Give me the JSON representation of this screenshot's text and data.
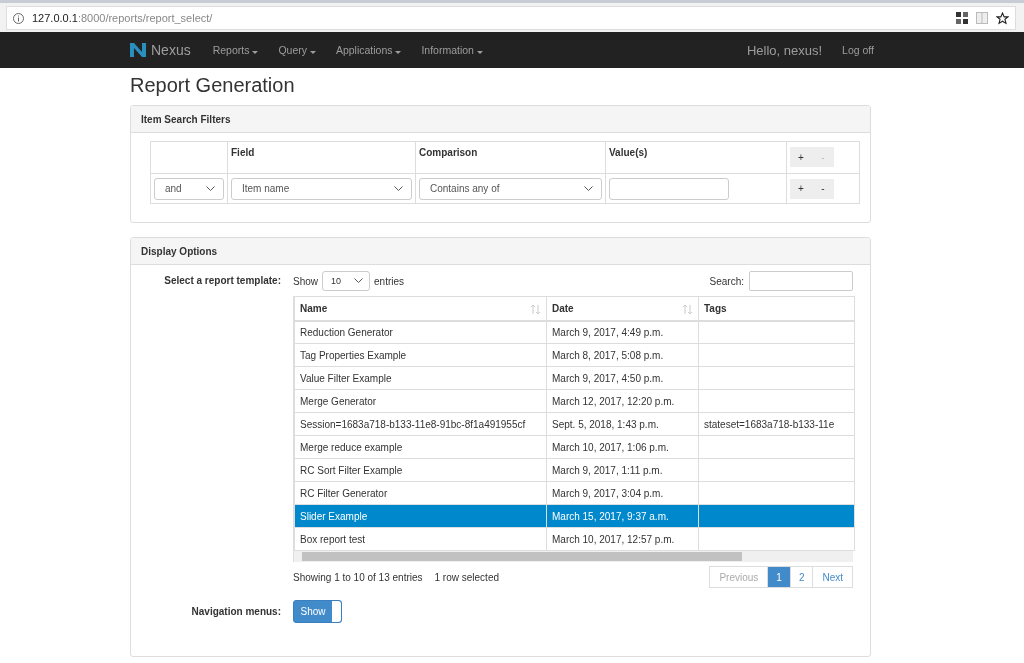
{
  "browser": {
    "url": "**127.0.0.1**:8000/reports/report_select/"
  },
  "navbar": {
    "brand": "Nexus",
    "menus": [
      "Reports",
      "Query",
      "Applications",
      "Information"
    ],
    "greeting": "Hello, nexus!",
    "logoff": "Log off"
  },
  "page_title": "Report Generation",
  "filters_panel": {
    "title": "Item Search Filters",
    "columns": [
      "Field",
      "Comparison",
      "Value(s)"
    ],
    "header_buttons": [
      {
        "label": "+",
        "disabled": false
      },
      {
        "label": "-",
        "disabled": true
      }
    ],
    "rows": [
      {
        "conjunction": "and",
        "field": "Item name",
        "comparison": "Contains any of",
        "value": "",
        "buttons": [
          {
            "label": "+",
            "disabled": false
          },
          {
            "label": "-",
            "disabled": false
          }
        ]
      }
    ]
  },
  "display_panel": {
    "title": "Display Options",
    "template_label": "Select a report template:",
    "length": {
      "before": "Show",
      "value": "10",
      "after": "entries"
    },
    "search_label": "Search:",
    "columns": [
      {
        "label": "Name",
        "sortable": true
      },
      {
        "label": "Date",
        "sortable": true
      },
      {
        "label": "Tags",
        "sortable": false
      }
    ],
    "rows": [
      {
        "cells": [
          "Reduction Generator",
          "March 9, 2017, 4:49 p.m.",
          ""
        ],
        "selected": false
      },
      {
        "cells": [
          "Tag Properties Example",
          "March 8, 2017, 5:08 p.m.",
          ""
        ],
        "selected": false
      },
      {
        "cells": [
          "Value Filter Example",
          "March 9, 2017, 4:50 p.m.",
          ""
        ],
        "selected": false
      },
      {
        "cells": [
          "Merge Generator",
          "March 12, 2017, 12:20 p.m.",
          ""
        ],
        "selected": false
      },
      {
        "cells": [
          "Session=1683a718-b133-11e8-91bc-8f1a491955cf",
          "Sept. 5, 2018, 1:43 p.m.",
          "stateset=1683a718-b133-11e"
        ],
        "selected": false
      },
      {
        "cells": [
          "Merge reduce example",
          "March 10, 2017, 1:06 p.m.",
          ""
        ],
        "selected": false
      },
      {
        "cells": [
          "RC Sort Filter Example",
          "March 9, 2017, 1:11 p.m.",
          ""
        ],
        "selected": false
      },
      {
        "cells": [
          "RC Filter Generator",
          "March 9, 2017, 3:04 p.m.",
          ""
        ],
        "selected": false
      },
      {
        "cells": [
          "Slider Example",
          "March 15, 2017, 9:37 a.m.",
          ""
        ],
        "selected": true
      },
      {
        "cells": [
          "Box report test",
          "March 10, 2017, 12:57 p.m.",
          ""
        ],
        "selected": false
      }
    ],
    "info": "Showing 1 to 10 of 13 entries",
    "selection_info": "1 row selected",
    "pagination": [
      {
        "label": "Previous",
        "kind": "prev",
        "disabled": true,
        "selected": false
      },
      {
        "label": "1",
        "kind": "page",
        "disabled": false,
        "selected": true
      },
      {
        "label": "2",
        "kind": "page",
        "disabled": false,
        "selected": false
      },
      {
        "label": "Next",
        "kind": "next",
        "disabled": false,
        "selected": false
      }
    ],
    "nav_menus_label": "Navigation menus:",
    "nav_toggle": {
      "label": "Show",
      "on": true
    }
  }
}
